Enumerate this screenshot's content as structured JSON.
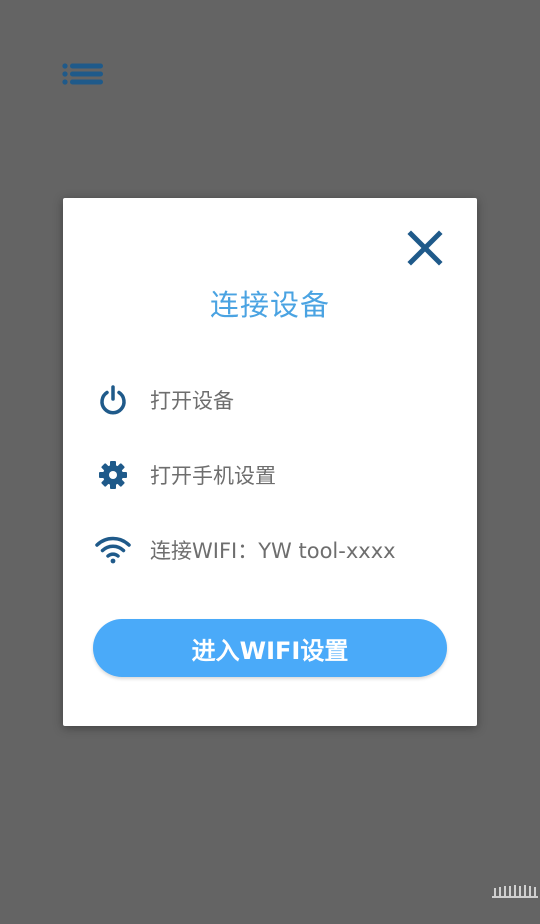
{
  "app": {
    "menu_icon": "list-menu-icon"
  },
  "dialog": {
    "title": "连接设备",
    "close_icon": "close-icon",
    "steps": [
      {
        "icon": "power-icon",
        "label": "打开设备"
      },
      {
        "icon": "gear-icon",
        "label": "打开手机设置"
      },
      {
        "icon": "wifi-icon",
        "label": "连接WIFI：YW tool-xxxx"
      }
    ],
    "enter_button_label": "进入WIFI设置"
  },
  "colors": {
    "overlay": "#646464",
    "accent_dark": "#1f5a8a",
    "title_blue": "#4aa3e2",
    "button_blue": "#4aaaf9",
    "label_gray": "#6e6e6e"
  }
}
